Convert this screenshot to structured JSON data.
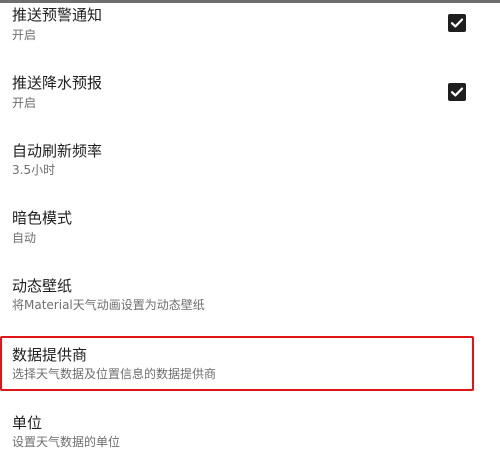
{
  "settings": {
    "items": [
      {
        "title": "推送预警通知",
        "summary": "开启",
        "checked": true
      },
      {
        "title": "推送降水预报",
        "summary": "开启",
        "checked": true
      },
      {
        "title": "自动刷新频率",
        "summary": "3.5小时"
      },
      {
        "title": "暗色模式",
        "summary": "自动"
      },
      {
        "title": "动态壁纸",
        "summary": "将Material天气动画设置为动态壁纸"
      },
      {
        "title": "数据提供商",
        "summary": "选择天气数据及位置信息的数据提供商"
      },
      {
        "title": "单位",
        "summary": "设置天气数据的单位"
      }
    ]
  },
  "colors": {
    "highlight": "#e01616",
    "checkbox": "#1e1e1e"
  }
}
